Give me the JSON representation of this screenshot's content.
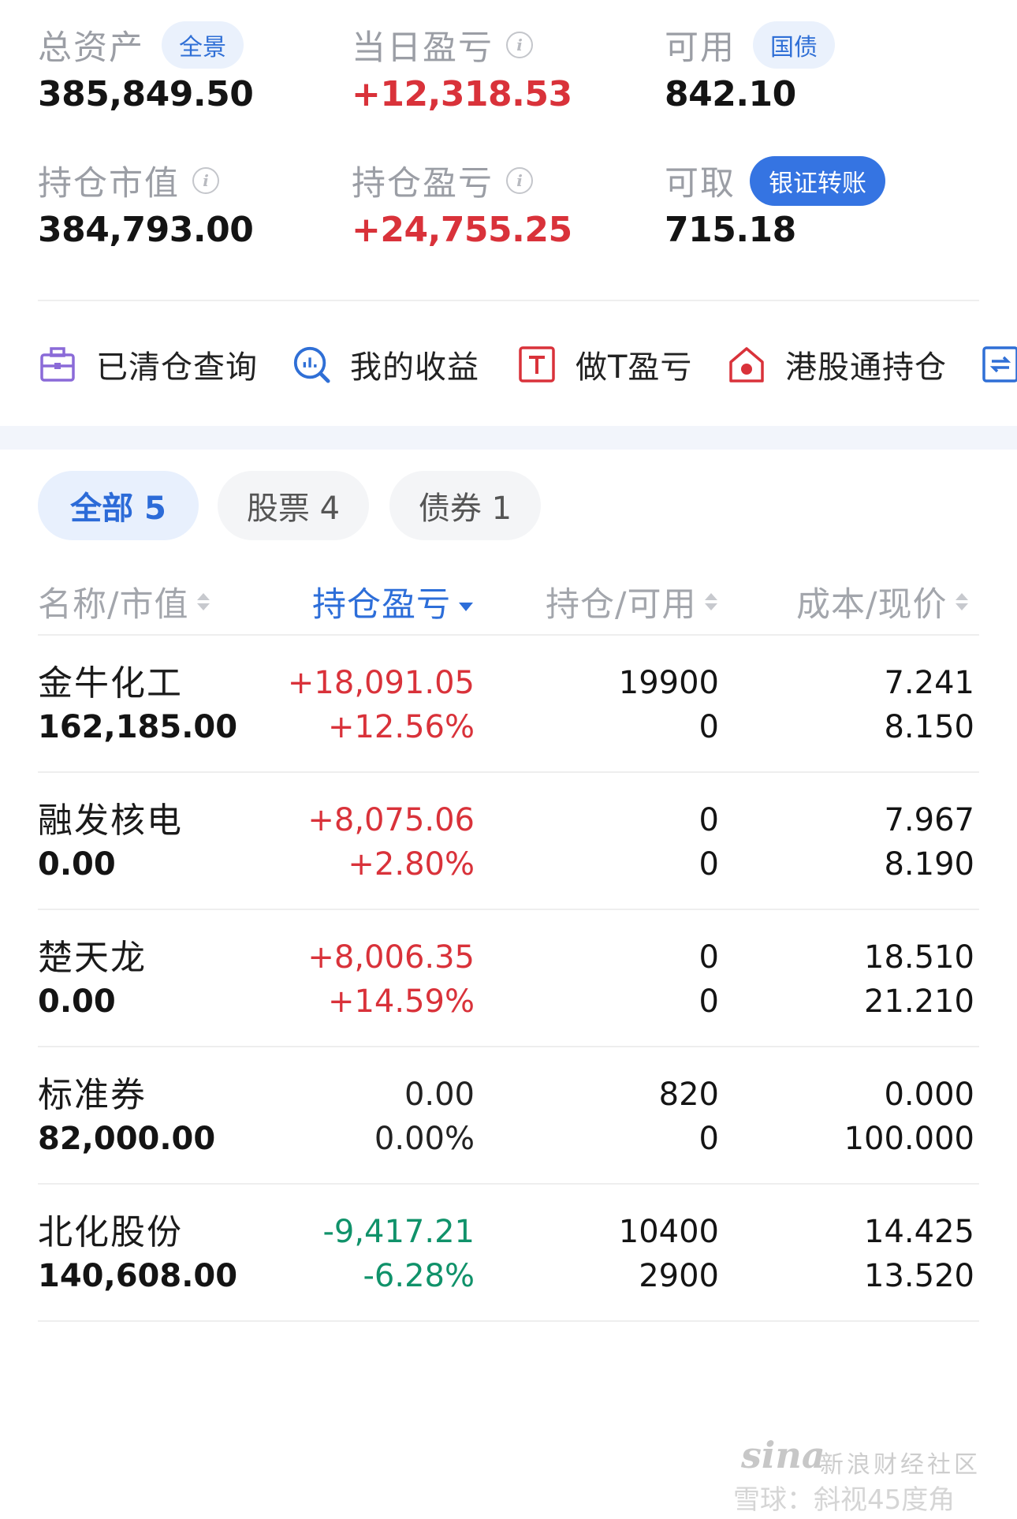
{
  "summary": {
    "total_assets": {
      "label": "总资产",
      "value": "385,849.50",
      "tag": "全景"
    },
    "daily_pl": {
      "label": "当日盈亏",
      "value": "+12,318.53"
    },
    "available": {
      "label": "可用",
      "value": "842.10",
      "tag": "国债"
    },
    "market_value": {
      "label": "持仓市值",
      "value": "384,793.00"
    },
    "position_pl": {
      "label": "持仓盈亏",
      "value": "+24,755.25"
    },
    "withdrawable": {
      "label": "可取",
      "value": "715.18",
      "tag": "银证转账"
    }
  },
  "quick_menu": [
    {
      "label": "已清仓查询",
      "icon": "briefcase-icon"
    },
    {
      "label": "我的收益",
      "icon": "chart-search-icon"
    },
    {
      "label": "做T盈亏",
      "icon": "t-box-icon"
    },
    {
      "label": "港股通持仓",
      "icon": "hk-house-icon"
    },
    {
      "label": "",
      "icon": "transfer-icon"
    }
  ],
  "tabs": [
    {
      "label": "全部 5",
      "active": true
    },
    {
      "label": "股票 4",
      "active": false
    },
    {
      "label": "债券 1",
      "active": false
    }
  ],
  "table": {
    "headers": [
      "名称/市值",
      "持仓盈亏",
      "持仓/可用",
      "成本/现价"
    ],
    "rows": [
      {
        "name": "金牛化工",
        "market_value": "162,185.00",
        "pl": "+18,091.05",
        "pl_pct": "+12.56%",
        "position": "19900",
        "available": "0",
        "cost": "7.241",
        "price": "8.150",
        "color": "red"
      },
      {
        "name": "融发核电",
        "market_value": "0.00",
        "pl": "+8,075.06",
        "pl_pct": "+2.80%",
        "position": "0",
        "available": "0",
        "cost": "7.967",
        "price": "8.190",
        "color": "red"
      },
      {
        "name": "楚天龙",
        "market_value": "0.00",
        "pl": "+8,006.35",
        "pl_pct": "+14.59%",
        "position": "0",
        "available": "0",
        "cost": "18.510",
        "price": "21.210",
        "color": "red"
      },
      {
        "name": "标准券",
        "market_value": "82,000.00",
        "pl": "0.00",
        "pl_pct": "0.00%",
        "position": "820",
        "available": "0",
        "cost": "0.000",
        "price": "100.000",
        "color": "plain"
      },
      {
        "name": "北化股份",
        "market_value": "140,608.00",
        "pl": "-9,417.21",
        "pl_pct": "-6.28%",
        "position": "10400",
        "available": "2900",
        "cost": "14.425",
        "price": "13.520",
        "color": "green"
      }
    ]
  },
  "watermark": {
    "brand": "sina",
    "brand_cn": "新浪财经社区",
    "line2": "雪球：斜视45度角"
  },
  "colors": {
    "red": "#d9323a",
    "green": "#10926a",
    "blue": "#3574e2"
  }
}
